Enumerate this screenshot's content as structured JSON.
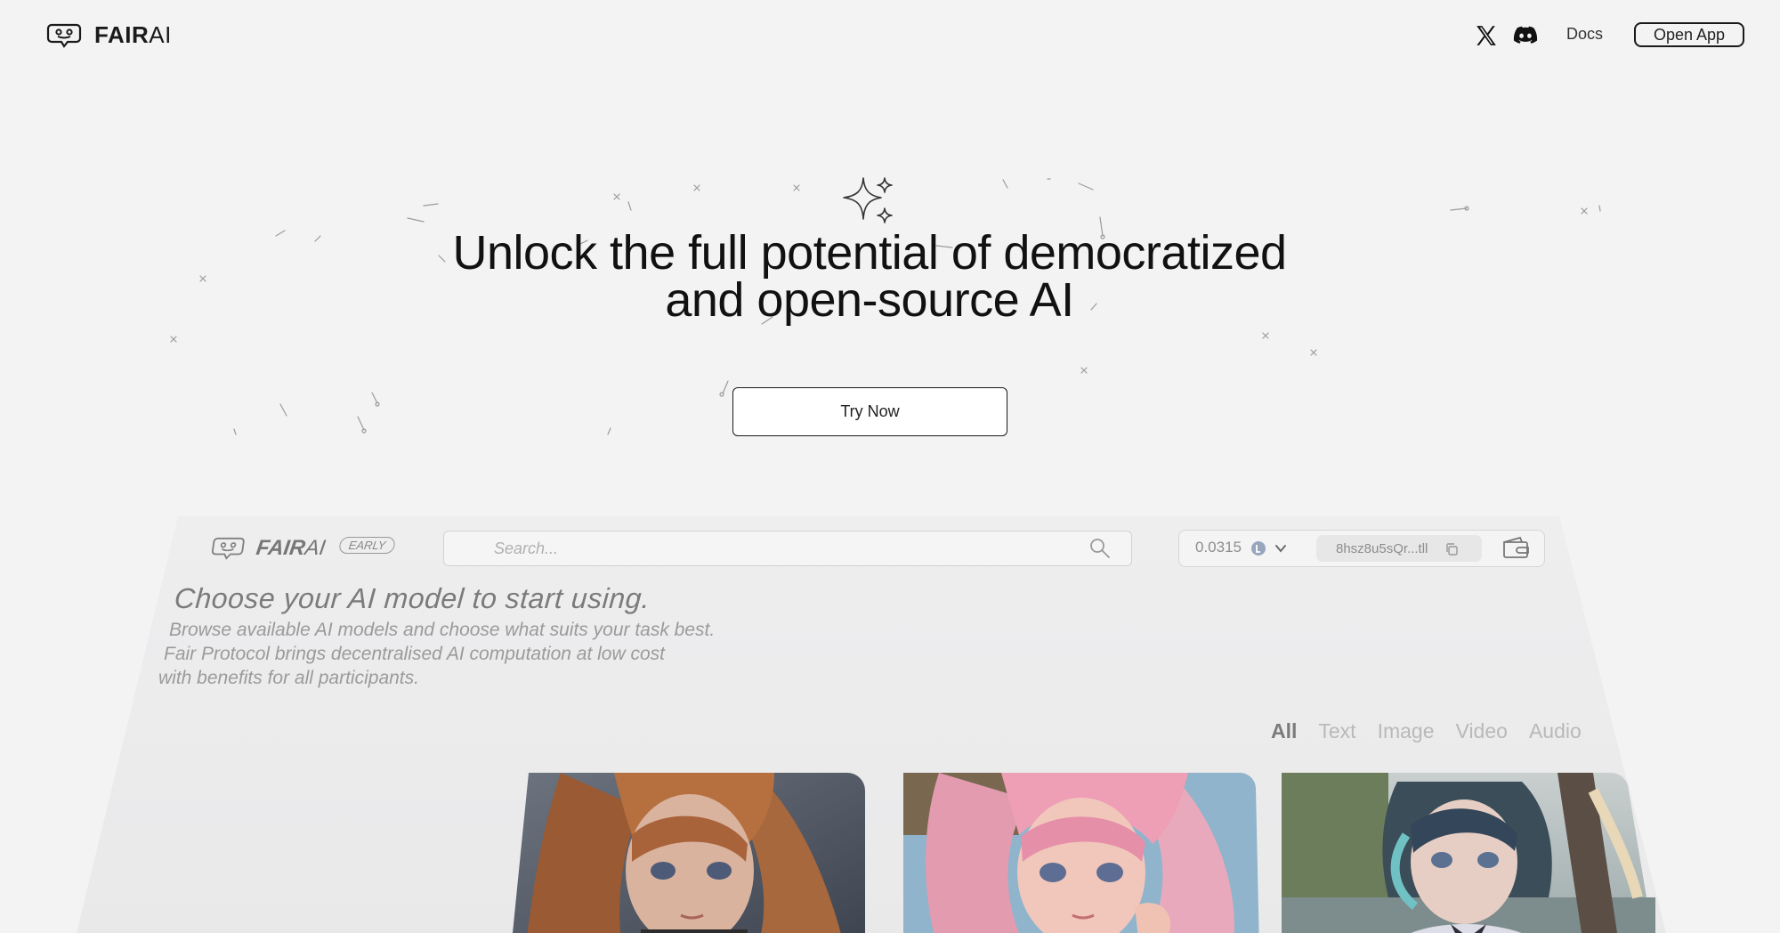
{
  "nav": {
    "brand_bold": "FAIR",
    "brand_light": "AI",
    "docs_label": "Docs",
    "open_app_label": "Open App"
  },
  "hero": {
    "title_line1": "Unlock the full potential of democratized",
    "title_line2": "and open-source AI",
    "cta_label": "Try Now"
  },
  "preview": {
    "brand_bold": "FAIR",
    "brand_light": "AI",
    "badge": "EARLY",
    "search_placeholder": "Search...",
    "balance": "0.0315",
    "address": "8hsz8u5sQr...tll",
    "heading": "Choose your AI model to start using.",
    "desc_line1": "Browse available AI models and choose what suits your task best.",
    "desc_line2": "Fair Protocol brings decentralised AI computation at low cost",
    "desc_line3": "with benefits for all participants.",
    "tabs": [
      {
        "label": "All",
        "active": true
      },
      {
        "label": "Text",
        "active": false
      },
      {
        "label": "Image",
        "active": false
      },
      {
        "label": "Video",
        "active": false
      },
      {
        "label": "Audio",
        "active": false
      }
    ],
    "cards": [
      {
        "subject": "anime-girl-auburn-hair"
      },
      {
        "subject": "anime-girl-pink-hair"
      },
      {
        "subject": "anime-girl-teal-hair-lakeside"
      }
    ]
  },
  "colors": {
    "background": "#f3f3f4",
    "preview_panel": "#ececec",
    "text_primary": "#111111",
    "text_muted": "#8a8a8a"
  },
  "icons": [
    "chat-bot-logo-icon",
    "x-twitter-icon",
    "discord-icon",
    "sparkle-icon",
    "search-icon",
    "coin-icon",
    "chevron-down-icon",
    "copy-icon",
    "wallet-icon"
  ]
}
